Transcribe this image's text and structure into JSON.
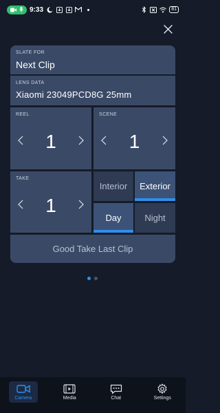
{
  "status_bar": {
    "time": "9:33",
    "battery": "81",
    "icons": [
      "camera-icon",
      "microphone-icon",
      "moon-icon",
      "download-icon",
      "download-icon",
      "gmail-icon",
      "dot-icon",
      "bluetooth-icon",
      "sim-off-icon",
      "wifi-icon",
      "battery-icon"
    ]
  },
  "slate": {
    "slate_for_label": "SLATE FOR",
    "slate_for_value": "Next Clip",
    "lens_label": "LENS DATA",
    "lens_value": "Xiaomi  23049PCD8G 25mm",
    "reel_label": "REEL",
    "reel_value": "1",
    "scene_label": "SCENE",
    "scene_value": "1",
    "take_label": "TAKE",
    "take_value": "1",
    "interior_label": "Interior",
    "exterior_label": "Exterior",
    "day_label": "Day",
    "night_label": "Night",
    "selected_location": "Exterior",
    "selected_time": "Day",
    "good_take_label": "Good Take Last Clip"
  },
  "pager": {
    "pages": 2,
    "current": 1
  },
  "nav": {
    "items": [
      {
        "label": "Camera",
        "icon": "camera-icon",
        "active": true
      },
      {
        "label": "Media",
        "icon": "film-icon",
        "active": false
      },
      {
        "label": "Chat",
        "icon": "chat-icon",
        "active": false
      },
      {
        "label": "Settings",
        "icon": "gear-icon",
        "active": false
      }
    ]
  },
  "colors": {
    "background": "#151b28",
    "cell": "#3a4a66",
    "accent": "#2e8ff0",
    "status_pill": "#2fbf6e"
  }
}
